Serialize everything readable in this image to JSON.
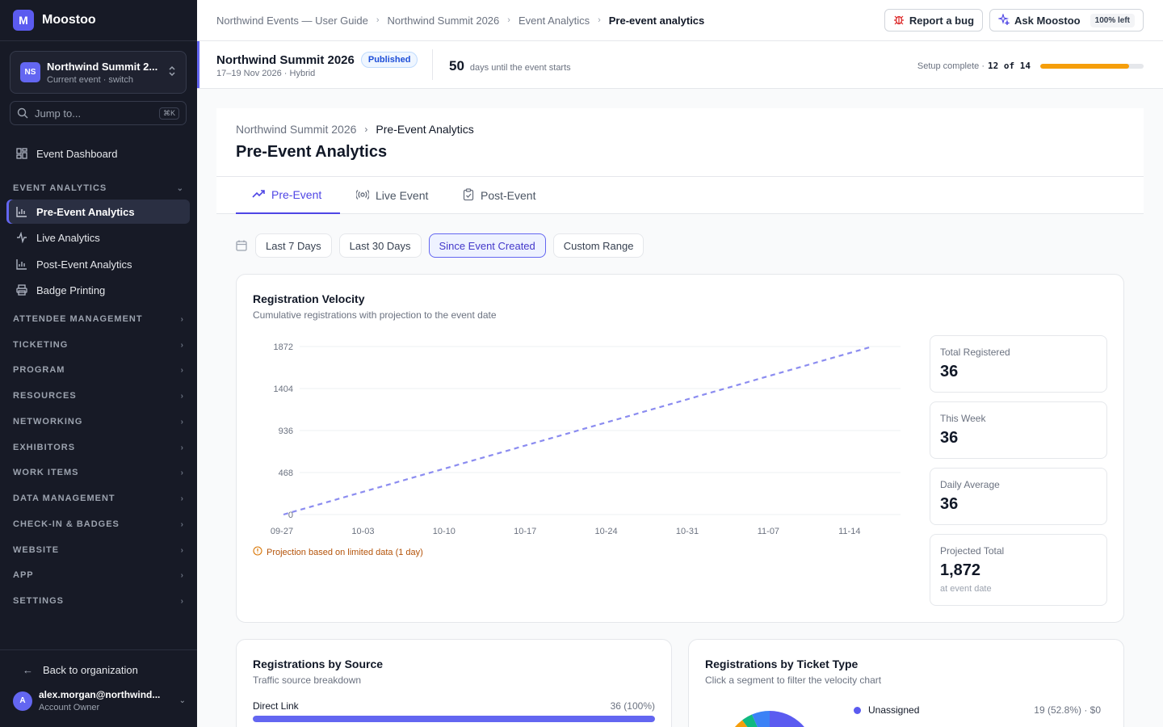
{
  "brand": {
    "logo": "M",
    "name": "Moostoo"
  },
  "event_switcher": {
    "initials": "NS",
    "name": "Northwind Summit 2...",
    "sub": "Current event · switch"
  },
  "jump": {
    "placeholder": "Jump to...",
    "shortcut": "⌘K"
  },
  "nav": {
    "dashboard": "Event Dashboard",
    "analytics_section": "EVENT ANALYTICS",
    "items": [
      "Pre-Event Analytics",
      "Live Analytics",
      "Post-Event Analytics",
      "Badge Printing"
    ],
    "sections": [
      "ATTENDEE MANAGEMENT",
      "TICKETING",
      "PROGRAM",
      "RESOURCES",
      "NETWORKING",
      "EXHIBITORS",
      "WORK ITEMS",
      "DATA MANAGEMENT",
      "CHECK-IN & BADGES",
      "WEBSITE",
      "APP",
      "SETTINGS"
    ]
  },
  "sidebar_footer": {
    "back": "Back to organization",
    "avatar": "A",
    "email": "alex.morgan@northwind...",
    "role": "Account Owner"
  },
  "topbar": {
    "crumbs": [
      "Northwind Events — User Guide",
      "Northwind Summit 2026",
      "Event Analytics",
      "Pre-event analytics"
    ],
    "report_bug": "Report a bug",
    "ask": "Ask Moostoo",
    "quota": "100% left"
  },
  "event_header": {
    "title": "Northwind Summit 2026",
    "status": "Published",
    "dates": "17–19 Nov 2026 · Hybrid",
    "days": "50",
    "days_text": "days until the event starts",
    "setup_label": "Setup complete ·",
    "setup_value": "12 of 14",
    "setup_progress": 0.857
  },
  "page": {
    "crumbs": [
      "Northwind Summit 2026",
      "Pre-Event Analytics"
    ],
    "title": "Pre-Event Analytics",
    "tabs": [
      "Pre-Event",
      "Live Event",
      "Post-Event"
    ]
  },
  "filters": [
    "Last 7 Days",
    "Last 30 Days",
    "Since Event Created",
    "Custom Range"
  ],
  "velocity": {
    "title": "Registration Velocity",
    "subtitle": "Cumulative registrations with projection to the event date",
    "warning": "Projection based on limited data (1 day)",
    "stats": [
      {
        "label": "Total Registered",
        "value": "36"
      },
      {
        "label": "This Week",
        "value": "36"
      },
      {
        "label": "Daily Average",
        "value": "36"
      },
      {
        "label": "Projected Total",
        "value": "1,872",
        "note": "at event date"
      }
    ]
  },
  "chart_data": {
    "type": "line",
    "x": [
      "09-27",
      "11-17"
    ],
    "x_ticks": [
      "09-27",
      "10-03",
      "10-10",
      "10-17",
      "10-24",
      "10-31",
      "11-07",
      "11-14"
    ],
    "y_ticks": [
      "0",
      "468",
      "936",
      "1404",
      "1872"
    ],
    "ylim": [
      0,
      1872
    ],
    "series": [
      {
        "style": "dashed",
        "color": "#8b8cf0",
        "values": [
          0,
          1872
        ]
      }
    ],
    "grid": true
  },
  "source": {
    "title": "Registrations by Source",
    "subtitle": "Traffic source breakdown",
    "rows": [
      {
        "name": "Direct Link",
        "value": "36 (100%)",
        "fraction": 1.0
      }
    ]
  },
  "ticket_type": {
    "title": "Registrations by Ticket Type",
    "subtitle": "Click a segment to filter the velocity chart",
    "legend": [
      {
        "name": "Unassigned",
        "value": "19 (52.8%) · $0",
        "color": "#5b5bf0"
      }
    ]
  }
}
